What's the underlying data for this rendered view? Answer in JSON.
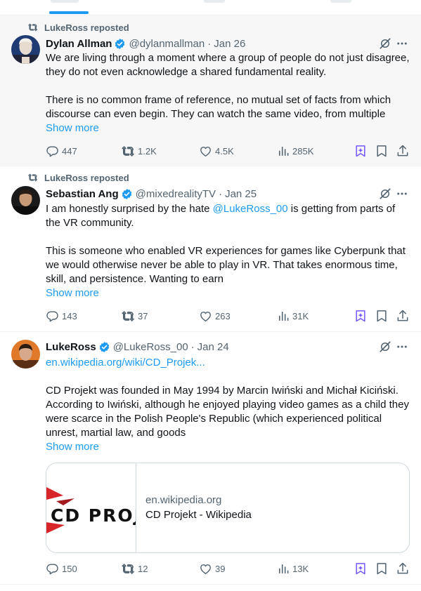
{
  "colors": {
    "accent": "#1d9bf0",
    "muted": "#536471",
    "grok": "#7856ff",
    "text": "#0f1419"
  },
  "tweets": [
    {
      "repost_label": "LukeRoss reposted",
      "name": "Dylan Allman",
      "handle": "@dylanmallman",
      "dot": "·",
      "date": "Jan 26",
      "text": "We are living through a moment where a group of people do not just disagree, they do not even acknowledge a shared fundamental reality.\n\nThere is no common frame of reference, no mutual set of facts from which discourse can even begin. They can watch the same video, from multiple",
      "show_more": "Show more",
      "replies": "447",
      "reposts": "1.2K",
      "likes": "4.5K",
      "views": "285K"
    },
    {
      "repost_label": "LukeRoss reposted",
      "name": "Sebastian Ang",
      "handle": "@mixedrealityTV",
      "dot": "·",
      "date": "Jan 25",
      "text_before": "I am honestly surprised by the hate ",
      "mention": "@LukeRoss_00",
      "text_after": " is getting from parts of the VR community.\n\nThis is someone who enabled VR experiences for games like Cyberpunk that we would otherwise never be able to play in VR. That takes enormous time, skill, and persistence. Wanting to earn",
      "show_more": "Show more",
      "replies": "143",
      "reposts": "37",
      "likes": "263",
      "views": "31K"
    },
    {
      "name": "LukeRoss",
      "handle": "@LukeRoss_00",
      "dot": "·",
      "date": "Jan 24",
      "link": "en.wikipedia.org/wiki/CD_Projek...",
      "text": "CD Projekt was founded in May 1994 by Marcin Iwiński and Michał Kiciński. According to Iwiński, although he enjoyed playing video games as a child they were scarce in the Polish People's Republic (which experienced political unrest, martial law, and goods",
      "show_more": "Show more",
      "card": {
        "logo_text": "CD PROJEKT",
        "domain": "en.wikipedia.org",
        "title": "CD Projekt - Wikipedia"
      },
      "replies": "150",
      "reposts": "12",
      "likes": "39",
      "views": "13K"
    }
  ]
}
